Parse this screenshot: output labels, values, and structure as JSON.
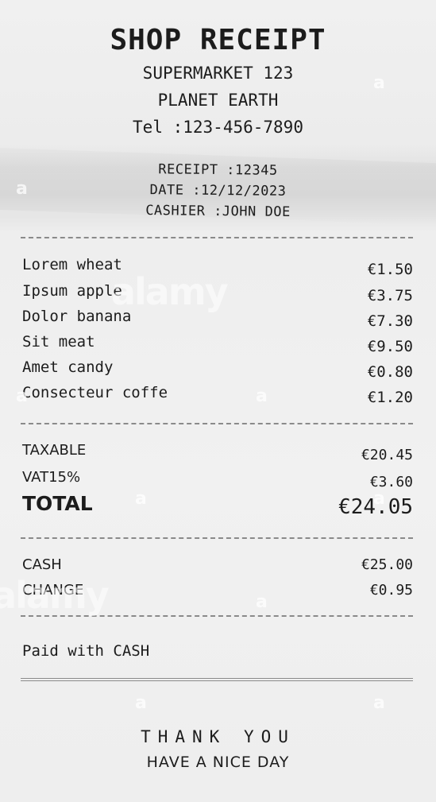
{
  "header": {
    "title": "SHOP RECEIPT",
    "store": "SUPERMARKET 123",
    "location": "PLANET EARTH",
    "tel": "Tel :123-456-7890"
  },
  "meta": {
    "receipt": "RECEIPT :12345",
    "date": "DATE :12/12/2023",
    "cashier": "CASHIER :JOHN DOE"
  },
  "items": [
    {
      "name": "Lorem wheat",
      "price": "€1.50"
    },
    {
      "name": "Ipsum apple",
      "price": "€3.75"
    },
    {
      "name": "Dolor banana",
      "price": "€7.30"
    },
    {
      "name": "Sit meat",
      "price": "€9.50"
    },
    {
      "name": "Amet candy",
      "price": "€0.80"
    },
    {
      "name": "Consecteur coffe",
      "price": "€1.20"
    }
  ],
  "summary": {
    "taxable_label": "TAXABLE",
    "taxable_value": "€20.45",
    "vat_label": "VAT15%",
    "vat_value": "€3.60",
    "total_label": "TOTAL",
    "total_value": "€24.05"
  },
  "payment": {
    "cash_label": "CASH",
    "cash_value": "€25.00",
    "change_label": "CHANGE",
    "change_value": "€0.95",
    "paid_with": "Paid with CASH"
  },
  "footer": {
    "thanks": "THANK YOU",
    "nice_day": "HAVE A NICE DAY"
  },
  "watermark": {
    "letter": "a",
    "brand": "alamy"
  }
}
